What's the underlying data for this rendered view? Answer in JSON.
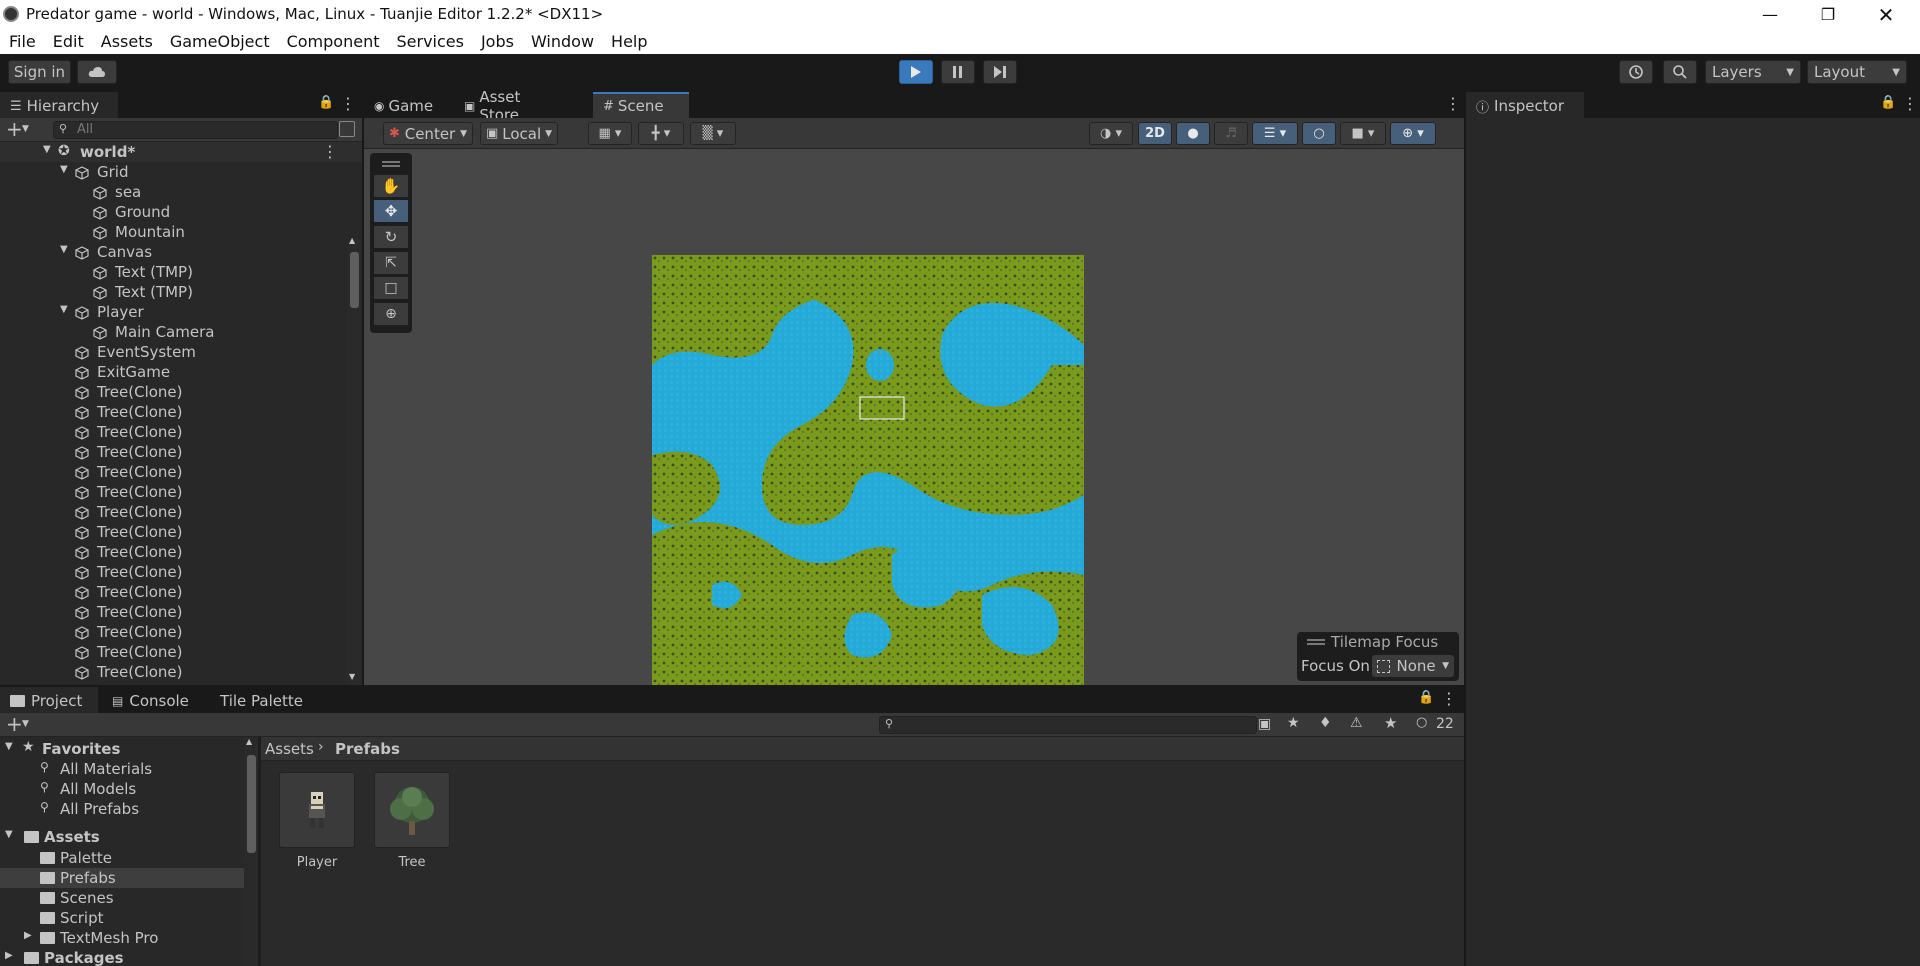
{
  "window": {
    "title": "Predator game - world - Windows, Mac, Linux - Tuanjie Editor 1.2.2* <DX11>"
  },
  "menu": [
    "File",
    "Edit",
    "Assets",
    "GameObject",
    "Component",
    "Services",
    "Jobs",
    "Window",
    "Help"
  ],
  "toolbar": {
    "sign_in": "Sign in",
    "layers": "Layers",
    "layout": "Layout"
  },
  "hierarchy": {
    "tab": "Hierarchy",
    "search_placeholder": "All",
    "scene_name": "world*",
    "items": [
      {
        "label": "Grid",
        "depth": 1,
        "expand": true
      },
      {
        "label": "sea",
        "depth": 2
      },
      {
        "label": "Ground",
        "depth": 2
      },
      {
        "label": "Mountain",
        "depth": 2
      },
      {
        "label": "Canvas",
        "depth": 1,
        "expand": true
      },
      {
        "label": "Text (TMP)",
        "depth": 2
      },
      {
        "label": "Text (TMP)",
        "depth": 2
      },
      {
        "label": "Player",
        "depth": 1,
        "expand": true
      },
      {
        "label": "Main Camera",
        "depth": 2
      },
      {
        "label": "EventSystem",
        "depth": 1
      },
      {
        "label": "ExitGame",
        "depth": 1
      },
      {
        "label": "Tree(Clone)",
        "depth": 1
      },
      {
        "label": "Tree(Clone)",
        "depth": 1
      },
      {
        "label": "Tree(Clone)",
        "depth": 1
      },
      {
        "label": "Tree(Clone)",
        "depth": 1
      },
      {
        "label": "Tree(Clone)",
        "depth": 1
      },
      {
        "label": "Tree(Clone)",
        "depth": 1
      },
      {
        "label": "Tree(Clone)",
        "depth": 1
      },
      {
        "label": "Tree(Clone)",
        "depth": 1
      },
      {
        "label": "Tree(Clone)",
        "depth": 1
      },
      {
        "label": "Tree(Clone)",
        "depth": 1
      },
      {
        "label": "Tree(Clone)",
        "depth": 1
      },
      {
        "label": "Tree(Clone)",
        "depth": 1
      },
      {
        "label": "Tree(Clone)",
        "depth": 1
      },
      {
        "label": "Tree(Clone)",
        "depth": 1
      },
      {
        "label": "Tree(Clone)",
        "depth": 1
      }
    ]
  },
  "scene": {
    "tabs": [
      "Game",
      "Asset Store",
      "Scene"
    ],
    "active_tab": "Scene",
    "pivot": "Center",
    "space": "Local",
    "mode_2d": "2D",
    "tilemap_focus": {
      "title": "Tilemap Focus",
      "label": "Focus On",
      "value": "None"
    }
  },
  "inspector": {
    "tab": "Inspector"
  },
  "project": {
    "tabs": [
      "Project",
      "Console",
      "Tile Palette"
    ],
    "active_tab": "Project",
    "hidden_count": "22",
    "favorites": {
      "label": "Favorites",
      "items": [
        "All Materials",
        "All Models",
        "All Prefabs"
      ]
    },
    "assets": {
      "label": "Assets",
      "items": [
        "Palette",
        "Prefabs",
        "Scenes",
        "Script",
        "TextMesh Pro"
      ],
      "selected": "Prefabs"
    },
    "packages_label": "Packages",
    "breadcrumb": [
      "Assets",
      "Prefabs"
    ],
    "prefabs": [
      {
        "name": "Player"
      },
      {
        "name": "Tree"
      }
    ]
  },
  "colors": {
    "accent": "#3a79bb",
    "water": "#25a9d6",
    "land": "#7a9a1c",
    "panel": "#282828",
    "bar": "#383838"
  }
}
